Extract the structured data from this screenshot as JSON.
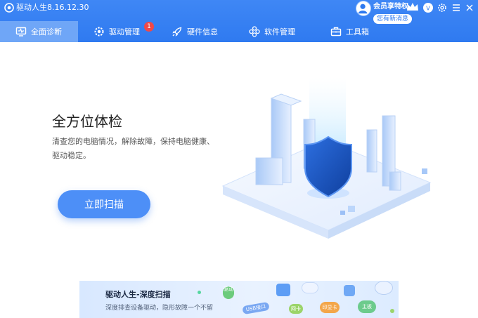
{
  "app": {
    "title": "驱动人生8.16.12.30"
  },
  "header": {
    "vip_label": "会员享特权",
    "message_badge": "您有新消息",
    "icons": [
      "user-avatar-icon",
      "crown-icon",
      "vip-badge-icon",
      "gear-icon",
      "menu-icon",
      "minimize-icon",
      "close-icon"
    ]
  },
  "nav": {
    "tabs": [
      {
        "label": "全面诊断",
        "icon": "monitor-icon",
        "active": true
      },
      {
        "label": "驱动管理",
        "icon": "gear-icon",
        "badge": "1"
      },
      {
        "label": "硬件信息",
        "icon": "rocket-icon"
      },
      {
        "label": "软件管理",
        "icon": "apps-icon"
      },
      {
        "label": "工具箱",
        "icon": "toolbox-icon"
      }
    ]
  },
  "hero": {
    "title": "全方位体检",
    "description": "清查您的电脑情况，解除故障，保持电脑健康、驱动稳定。",
    "scan_button": "立即扫描"
  },
  "banner": {
    "title": "驱动人生-深度扫描",
    "subtitle": "深度排查设备驱动，隐形故障一个不留",
    "chips": [
      "驱动",
      "USB接口",
      "网卡",
      "印显卡",
      "主板"
    ]
  },
  "colors": {
    "accent": "#2f7af0",
    "active_tab": "#6fa6f7",
    "badge": "#f04848",
    "button": "#4d8ff7"
  }
}
